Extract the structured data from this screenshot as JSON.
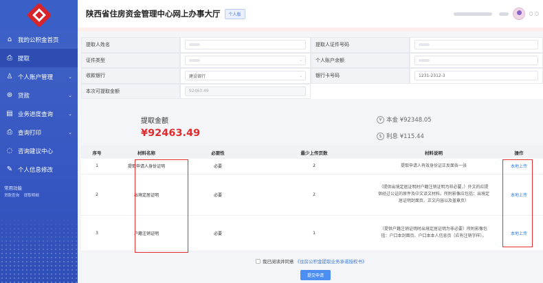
{
  "sidebar": {
    "items": [
      {
        "label": "我的公积金首页",
        "icon": "home-icon",
        "glyph": "⌂",
        "chevron": false,
        "active": false
      },
      {
        "label": "提取",
        "icon": "withdraw-icon",
        "glyph": "⎙",
        "chevron": false,
        "active": true
      },
      {
        "label": "个人账户管理",
        "icon": "user-icon",
        "glyph": "♙",
        "chevron": true,
        "active": false
      },
      {
        "label": "贷款",
        "icon": "loan-icon",
        "glyph": "⊛",
        "chevron": true,
        "active": false
      },
      {
        "label": "业务进度查询",
        "icon": "progress-icon",
        "glyph": "▤",
        "chevron": true,
        "active": false
      },
      {
        "label": "查询打印",
        "icon": "printer-icon",
        "glyph": "⎙",
        "chevron": true,
        "active": false
      },
      {
        "label": "咨询建议中心",
        "icon": "chat-icon",
        "glyph": "◌",
        "chevron": false,
        "active": false
      },
      {
        "label": "个人信息修改",
        "icon": "edit-icon",
        "glyph": "✎",
        "chevron": false,
        "active": false
      }
    ],
    "quick_title": "常用功能",
    "quick_links": [
      "贷款查询",
      "提取明细"
    ]
  },
  "header": {
    "title": "陕西省住房资金管理中心网上办事大厅",
    "badge": "个人版"
  },
  "form": {
    "rows": [
      [
        {
          "label": "提取人姓名",
          "value": "",
          "type": "text"
        },
        {
          "label": "提取人证件号码",
          "value": "",
          "type": "text"
        }
      ],
      [
        {
          "label": "证件类型",
          "value": "",
          "type": "select"
        },
        {
          "label": "个人账户余额",
          "value": "",
          "type": "text"
        }
      ],
      [
        {
          "label": "收款银行",
          "value": "建设银行",
          "type": "select"
        },
        {
          "label": "银行卡号码",
          "value": "1231-2312-3",
          "type": "text"
        }
      ],
      [
        {
          "label": "本次可提取金额",
          "value": "92463.49",
          "type": "disabled"
        }
      ]
    ]
  },
  "summary": {
    "amount_label": "提取金额",
    "amount_value": "¥92463.49",
    "principal": "本金 ¥92348.05",
    "interest": "利息 ¥115.44",
    "principal_icon": "¥",
    "interest_icon": "$"
  },
  "table": {
    "headers": [
      "序号",
      "材料名称",
      "必要性",
      "最少上传页数",
      "材料说明",
      "操作"
    ],
    "rows": [
      {
        "no": "1",
        "name": "提取申请人身份证明",
        "required": "必要",
        "pages": "2",
        "desc": "提取申请人有效身份证正反面各一张",
        "action": "本地上传"
      },
      {
        "no": "2",
        "name": "出境定居证明",
        "required": "必要",
        "pages": "2",
        "desc": "（提供出境定居证明时户籍注销证明为非必要，）外文的应提供经过公证的原件及中文译文材料。所附影像应包括：出境定居证明封面页、正文内容以及盖章页）",
        "action": "本地上传"
      },
      {
        "no": "3",
        "name": "户籍注销证明",
        "required": "必要",
        "pages": "1",
        "desc": "（提供户籍注销证明时出境定居证明为非必要）所附影像包括：户口本封面页、户口本本人信息页（应有注销字样）。",
        "action": "本地上传"
      }
    ]
  },
  "footer": {
    "agree_text": "我已阅读并同意",
    "agree_link": "《住房公积金提取业务承诺授权书》",
    "submit_label": "提交申请"
  },
  "colors": {
    "sidebar": "#3657c1",
    "accent": "#4c8ef2",
    "amount": "#e02c2c",
    "highlight_box": "#e12d2d"
  }
}
